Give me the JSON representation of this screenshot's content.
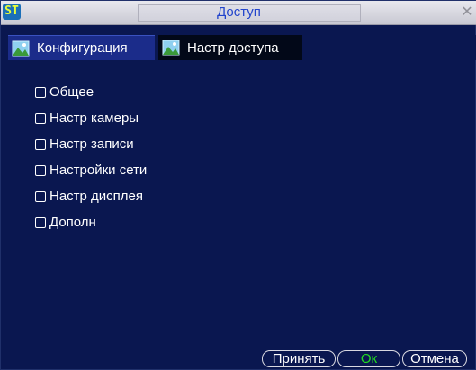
{
  "window": {
    "title": "Доступ",
    "logo_text": "ST",
    "close_icon": "close-icon"
  },
  "tabs": [
    {
      "label": "Конфигурация",
      "icon": "picture-icon",
      "active": true
    },
    {
      "label": "Настр доступа",
      "icon": "picture-icon",
      "active": false
    }
  ],
  "permissions": [
    {
      "label": "Общее",
      "checked": false
    },
    {
      "label": "Настр камеры",
      "checked": false
    },
    {
      "label": "Настр записи",
      "checked": false
    },
    {
      "label": "Настройки сети",
      "checked": false
    },
    {
      "label": "Настр дисплея",
      "checked": false
    },
    {
      "label": "Дополн",
      "checked": false
    }
  ],
  "buttons": {
    "apply": "Принять",
    "ok": "Ок",
    "cancel": "Отмена"
  },
  "colors": {
    "background": "#0a1750",
    "active_tab": "#1b2c8a",
    "title": "#2244cc",
    "ok_text": "#22dd22"
  }
}
